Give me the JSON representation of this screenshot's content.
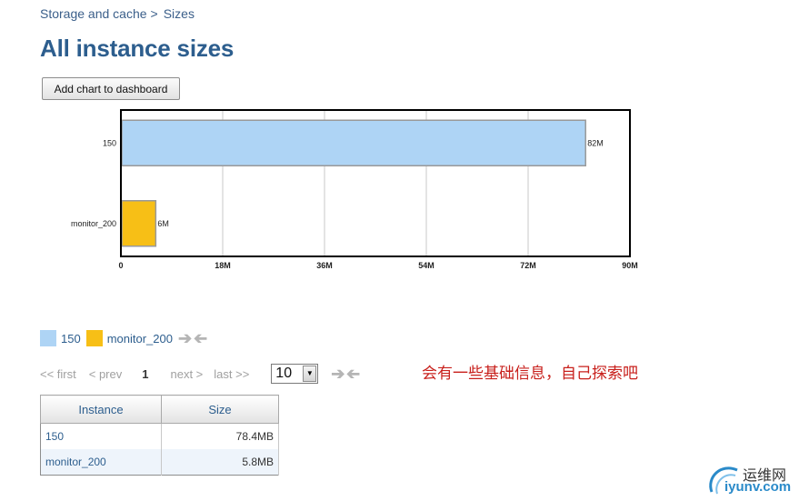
{
  "breadcrumb": {
    "parent": "Storage and cache",
    "separator": ">",
    "current": "Sizes"
  },
  "page_title": "All instance sizes",
  "toolbar": {
    "add_chart_label": "Add chart to dashboard"
  },
  "chart_data": {
    "type": "bar",
    "orientation": "horizontal",
    "categories": [
      "150",
      "monitor_200"
    ],
    "values": [
      82,
      6
    ],
    "value_labels": [
      "82M",
      "6M"
    ],
    "colors": [
      "#aed4f5",
      "#f7bf16"
    ],
    "xlim": [
      0,
      90
    ],
    "xticks": [
      "0",
      "18M",
      "36M",
      "54M",
      "72M",
      "90M"
    ],
    "grid": true
  },
  "legend": [
    {
      "label": "150",
      "color": "#aed4f5"
    },
    {
      "label": "monitor_200",
      "color": "#f7bf16"
    }
  ],
  "pager": {
    "first": "<< first",
    "prev": "< prev",
    "current": "1",
    "next": "next >",
    "last": "last >>",
    "page_size": "10"
  },
  "note": "会有一些基础信息，自己探索吧",
  "table": {
    "headers": [
      "Instance",
      "Size"
    ],
    "rows": [
      {
        "instance": "150",
        "size": "78.4MB"
      },
      {
        "instance": "monitor_200",
        "size": "5.8MB"
      }
    ]
  },
  "watermark": {
    "cn": "运维网",
    "en": "iyunv.com"
  }
}
